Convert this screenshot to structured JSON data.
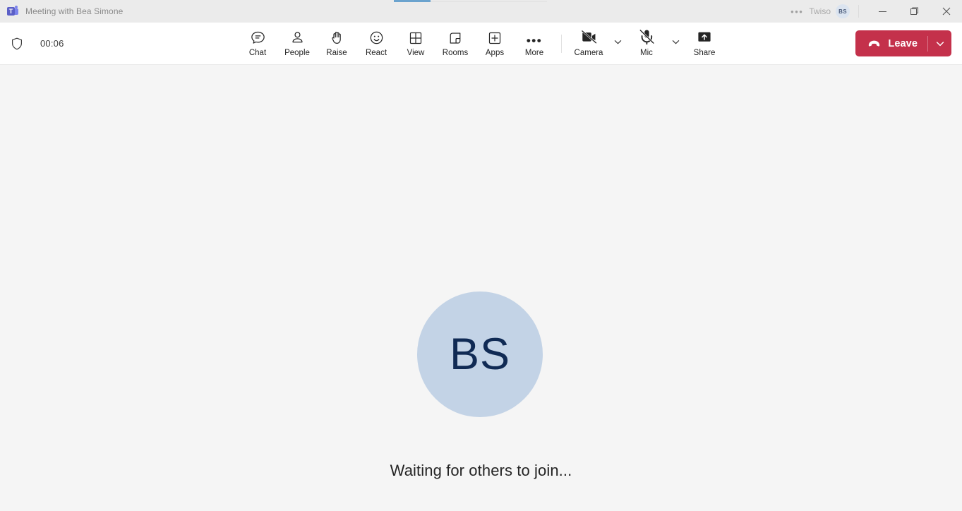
{
  "titlebar": {
    "app_logo": "teams-logo",
    "logo_letter": "T",
    "title": "Meeting with Bea Simone",
    "overflow": "•••",
    "org": "Twiso",
    "avatar_initials": "BS",
    "minimize_label": "Minimize",
    "restore_label": "Restore",
    "close_label": "Close"
  },
  "toolbar": {
    "shield_icon": "shield-icon",
    "timer": "00:06",
    "items": [
      {
        "label": "Chat",
        "icon": "chat-icon"
      },
      {
        "label": "People",
        "icon": "people-icon"
      },
      {
        "label": "Raise",
        "icon": "raise-hand-icon"
      },
      {
        "label": "React",
        "icon": "react-smiley-icon"
      },
      {
        "label": "View",
        "icon": "view-grid-icon"
      },
      {
        "label": "Rooms",
        "icon": "rooms-icon"
      },
      {
        "label": "Apps",
        "icon": "apps-plus-icon"
      },
      {
        "label": "More",
        "icon": "more-ellipsis-icon"
      }
    ],
    "camera": {
      "label": "Camera",
      "icon": "camera-off-icon",
      "muted": true
    },
    "mic": {
      "label": "Mic",
      "icon": "mic-off-icon",
      "muted": true
    },
    "share": {
      "label": "Share",
      "icon": "share-screen-icon"
    },
    "leave": {
      "label": "Leave",
      "icon": "hangup-icon",
      "color": "#c4314b"
    }
  },
  "stage": {
    "avatar_initials": "BS",
    "avatar_bg": "#c3d3e6",
    "avatar_fg": "#102a54",
    "status_text": "Waiting for others to join..."
  }
}
